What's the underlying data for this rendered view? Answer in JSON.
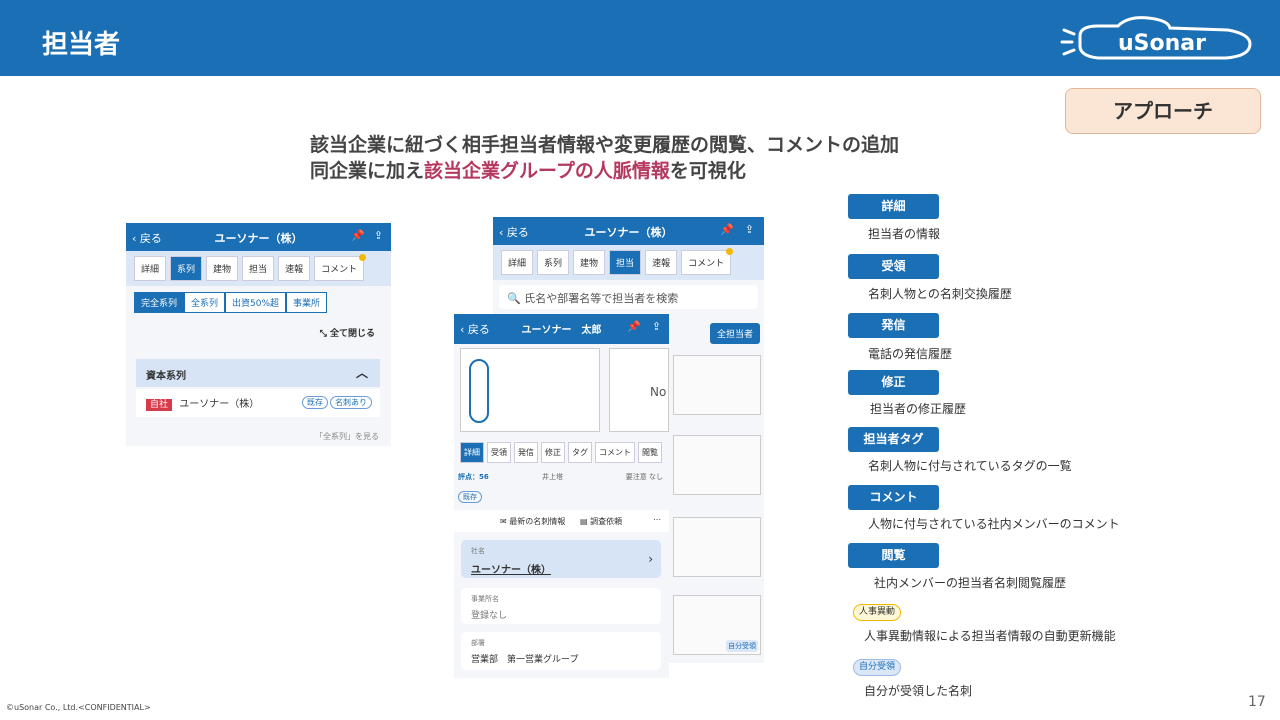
{
  "slide": {
    "title": "担当者",
    "approach_label": "アプローチ",
    "headline_line1": "該当企業に紐づく相手担当者情報や変更履歴の閲覧、コメントの追加",
    "headline_line2_pre": "同企業に加え",
    "headline_line2_highlight": "該当企業グループの人脈情報",
    "headline_line2_post": "を可視化",
    "footer": "©uSonar Co., Ltd.<CONFIDENTIAL>",
    "page_number": "17"
  },
  "logo": {
    "text": "uSonar"
  },
  "screen1": {
    "back": "戻る",
    "title": "ユーソナー（株）",
    "tabs": [
      "詳細",
      "系列",
      "建物",
      "担当",
      "速報",
      "コメント"
    ],
    "active_tab": "系列",
    "filters": [
      "完全系列",
      "全系列",
      "出資50%超",
      "事業所"
    ],
    "collapse_all": "全て閉じる",
    "section_title": "資本系列",
    "company_badge": "自社",
    "company_name": "ユーソナー（株）",
    "badge_existing": "既存",
    "badge_card": "名刺あり",
    "see_all": "「全系列」を見る"
  },
  "screen2": {
    "back": "戻る",
    "title": "ユーソナー（株）",
    "tabs": [
      "詳細",
      "系列",
      "建物",
      "担当",
      "速報",
      "コメント"
    ],
    "active_tab": "担当",
    "search_placeholder": "氏名や部署名等で担当者を検索",
    "all_contacts": "全担当者",
    "self_received": "自分受領"
  },
  "screen3": {
    "back": "戻る",
    "title": "ユーソナー　太郎",
    "card_partial_text": "No",
    "tabs": [
      "詳細",
      "受領",
      "発信",
      "修正",
      "タグ",
      "コメント",
      "閲覧"
    ],
    "active_tab": "詳細",
    "score_label": "評点：56",
    "owner": "井上塔",
    "caution": "要注意 なし",
    "status_badge": "既存",
    "latest_card_info": "最新の名刺情報",
    "investigation_request": "調査依頼",
    "company_label": "社名",
    "company_value": "ユーソナー（株）",
    "office_label": "事業所名",
    "office_value": "登録なし",
    "dept_label": "部署",
    "dept_value": "営業部　第一営業グループ"
  },
  "legend": [
    {
      "label": "詳細",
      "desc": "担当者の情報"
    },
    {
      "label": "受領",
      "desc": "名刺人物との名刺交換履歴"
    },
    {
      "label": "発信",
      "desc": "電話の発信履歴"
    },
    {
      "label": "修正",
      "desc": "担当者の修正履歴"
    },
    {
      "label": "担当者タグ",
      "desc": "名刺人物に付与されているタグの一覧"
    },
    {
      "label": "コメント",
      "desc": "人物に付与されている社内メンバーのコメント"
    },
    {
      "label": "閲覧",
      "desc": "社内メンバーの担当者名刺閲覧履歴"
    }
  ],
  "chips": [
    {
      "label": "人事異動",
      "desc": "人事異動情報による担当者情報の自動更新機能"
    },
    {
      "label": "自分受領",
      "desc": "自分が受領した名刺"
    }
  ],
  "colors": {
    "brand_blue": "#1b6fb5",
    "highlight": "#b5385f",
    "approach_bg": "#fbe6d6"
  }
}
